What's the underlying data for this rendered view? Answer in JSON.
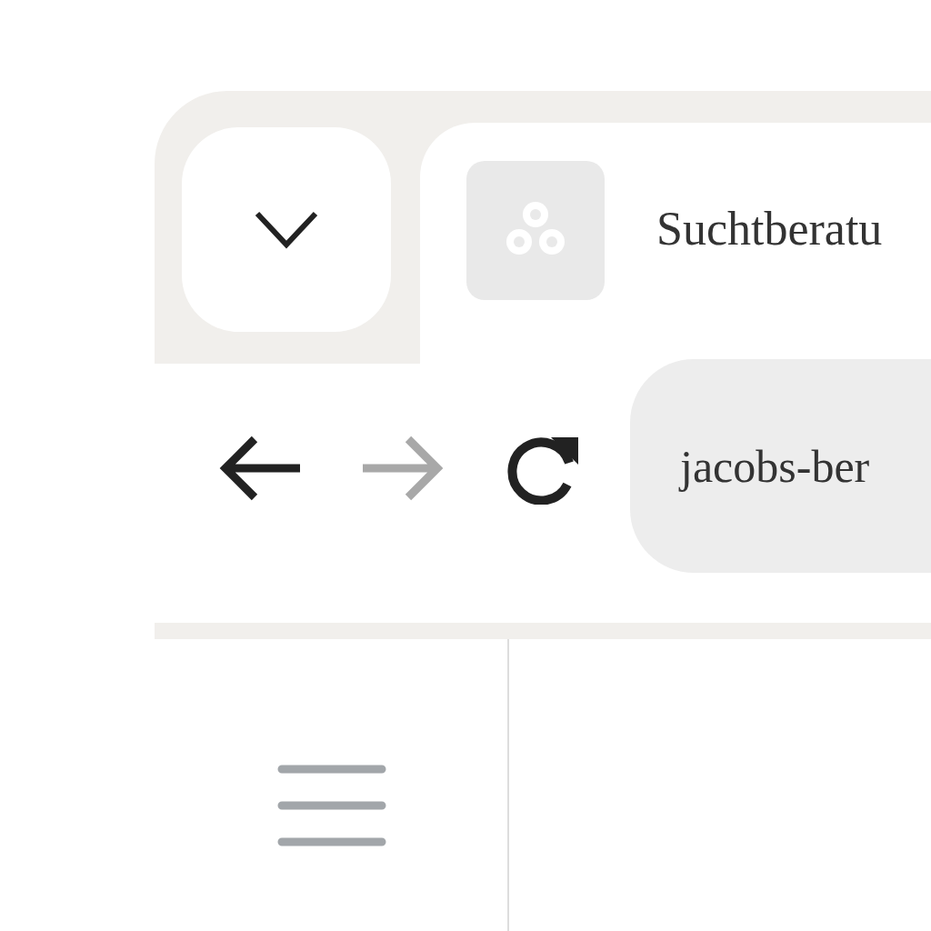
{
  "tab": {
    "title": "Suchtberatu"
  },
  "nav_buttons": [
    {
      "kind": "back",
      "disabled": false
    },
    {
      "kind": "forward",
      "disabled": true
    },
    {
      "kind": "reload",
      "disabled": false
    }
  ],
  "address_bar": {
    "value": "jacobs-ber"
  }
}
